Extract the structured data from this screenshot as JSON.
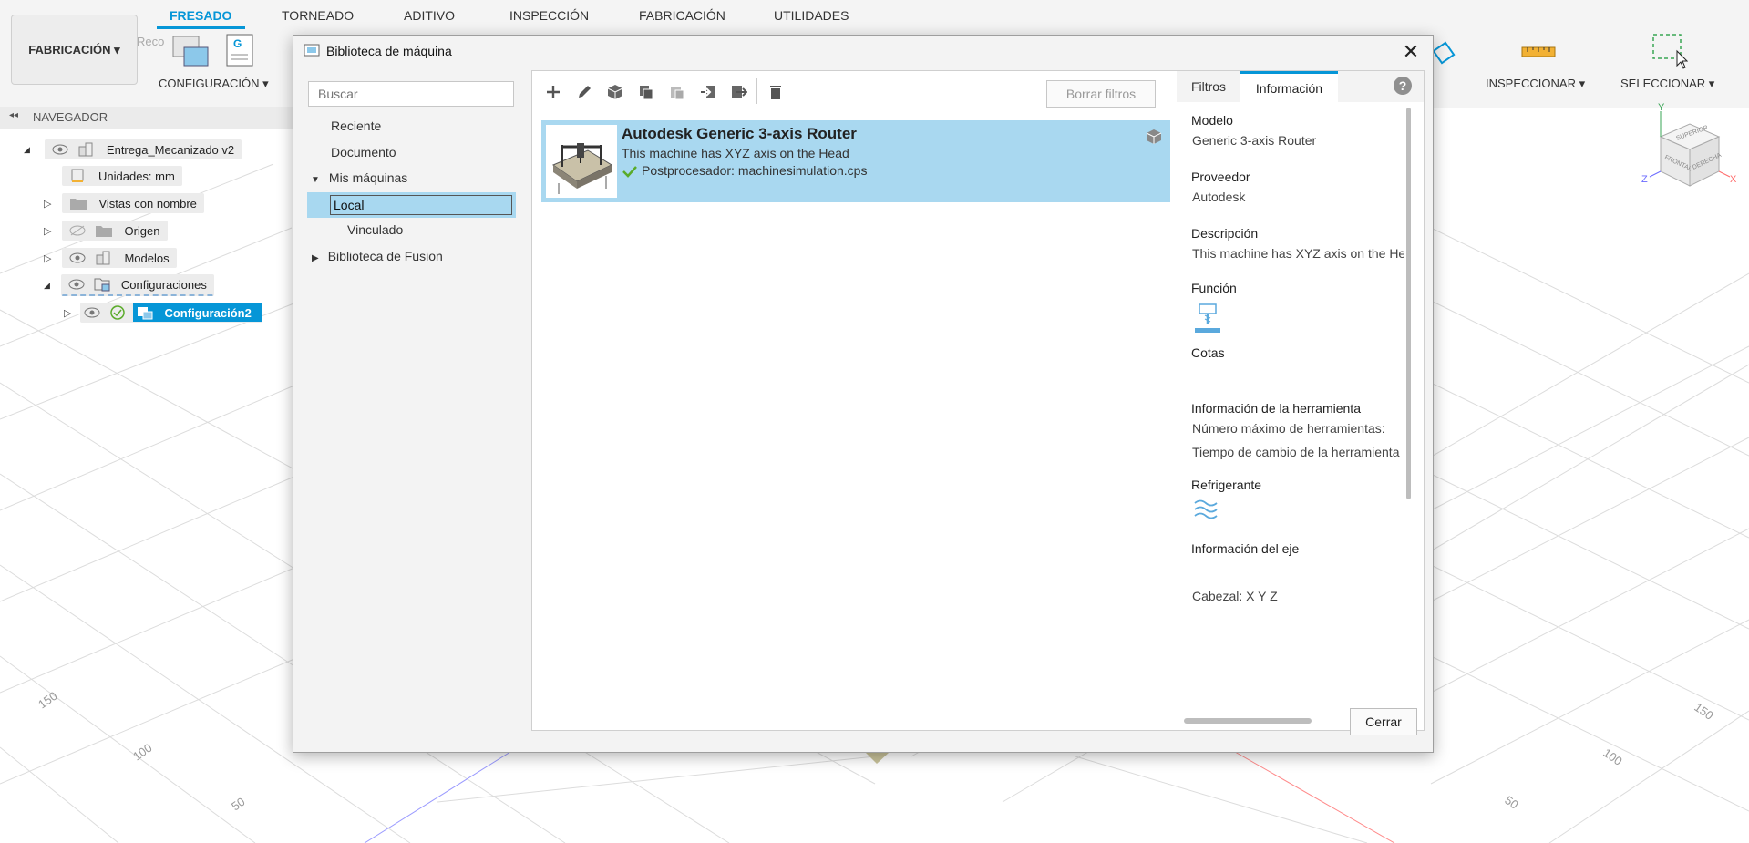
{
  "toolbar": {
    "workspace_label": "FABRICACIÓN ▾",
    "tabs": [
      "FRESADO",
      "TORNEADO",
      "ADITIVO",
      "INSPECCIÓN",
      "FABRICACIÓN",
      "UTILIDADES"
    ],
    "active_tab": "FRESADO",
    "groups": {
      "configuracion": "CONFIGURACIÓN ▾",
      "inspeccionar": "INSPECCIONAR ▾",
      "seleccionar": "SELECCIONAR ▾"
    },
    "partial_text": "Reco"
  },
  "browser": {
    "title": "NAVEGADOR",
    "items": [
      {
        "label": "Entrega_Mecanizado v2"
      },
      {
        "label": "Unidades: mm"
      },
      {
        "label": "Vistas con nombre"
      },
      {
        "label": "Origen"
      },
      {
        "label": "Modelos"
      },
      {
        "label": "Configuraciones"
      },
      {
        "label": "Configuración2"
      }
    ]
  },
  "dialog": {
    "title": "Biblioteca de máquina",
    "search_placeholder": "Buscar",
    "nav": {
      "reciente": "Reciente",
      "documento": "Documento",
      "mis_maquinas": "Mis máquinas",
      "local": "Local",
      "vinculado": "Vinculado",
      "biblioteca_fusion": "Biblioteca de Fusion"
    },
    "clear_filters": "Borrar filtros",
    "machine": {
      "name": "Autodesk Generic 3-axis Router",
      "description": "This machine has XYZ axis on the Head",
      "post": "Postprocesador: machinesimulation.cps"
    },
    "panel_tabs": {
      "filtros": "Filtros",
      "informacion": "Información"
    },
    "info": {
      "modelo_h": "Modelo",
      "modelo_v": "Generic 3-axis Router",
      "proveedor_h": "Proveedor",
      "proveedor_v": "Autodesk",
      "descripcion_h": "Descripción",
      "descripcion_v": "This machine has XYZ axis on the Head",
      "funcion_h": "Función",
      "cotas_h": "Cotas",
      "herramienta_h": "Información de la herramienta",
      "herramienta_v1": "Número máximo de herramientas:",
      "herramienta_v2": "Tiempo de cambio de la herramienta",
      "refrigerante_h": "Refrigerante",
      "eje_h": "Información del eje",
      "eje_v": "Cabezal: X Y Z"
    },
    "close_button": "Cerrar"
  },
  "viewcube": {
    "top": "SUPERIOR",
    "front": "FRONTAL",
    "right": "DERECHA",
    "axes": {
      "x": "X",
      "y": "Y",
      "z": "Z"
    }
  },
  "grid_labels": {
    "left": [
      "150",
      "100",
      "50"
    ],
    "right": [
      "150",
      "100",
      "50"
    ]
  },
  "colors": {
    "accent": "#0696d7",
    "selection": "#a9d8f0",
    "check": "#5aab2a"
  }
}
